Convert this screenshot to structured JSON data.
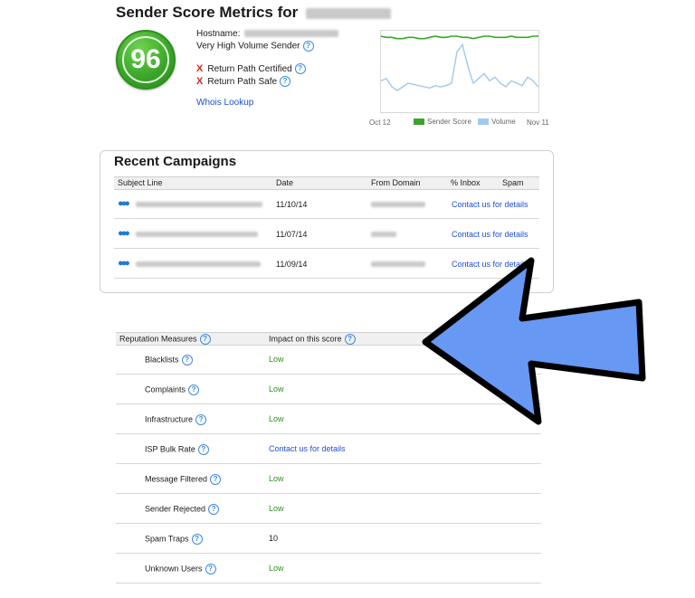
{
  "header": {
    "title": "Sender Score Metrics for",
    "score": "96",
    "hostname_label": "Hostname:",
    "volume_label": "Very High Volume Sender",
    "return_path_certified": "Return Path Certified",
    "return_path_safe": "Return Path Safe",
    "whois_link": "Whois Lookup",
    "x_mark": "X",
    "help_glyph": "?"
  },
  "trend_chart": {
    "x_start": "Oct 12",
    "x_end": "Nov 11",
    "legend": [
      "Sender Score",
      "Volume"
    ],
    "colors": {
      "score": "#3aa629",
      "volume": "#9ec9f0"
    }
  },
  "chart_data": {
    "type": "line",
    "x": [
      "Oct 12",
      "",
      "",
      "",
      "",
      "",
      "",
      "",
      "",
      "",
      "",
      "",
      "",
      "",
      "",
      "",
      "",
      "",
      "",
      "",
      "",
      "",
      "",
      "",
      "",
      "",
      "",
      "",
      "",
      "Nov 11"
    ],
    "series": [
      {
        "name": "Sender Score",
        "values": [
          97,
          96,
          96,
          95,
          95,
          96,
          96,
          95,
          95,
          96,
          97,
          96,
          96,
          97,
          97,
          96,
          96,
          95,
          96,
          97,
          97,
          96,
          96,
          96,
          97,
          96,
          96,
          96,
          97,
          97
        ]
      },
      {
        "name": "Volume",
        "values": [
          60,
          62,
          55,
          52,
          55,
          58,
          57,
          56,
          55,
          54,
          56,
          55,
          56,
          58,
          84,
          90,
          72,
          58,
          62,
          66,
          60,
          63,
          58,
          55,
          60,
          58,
          56,
          63,
          60,
          55
        ]
      }
    ],
    "ylim": [
      40,
      100
    ]
  },
  "campaigns": {
    "title": "Recent Campaigns",
    "columns": [
      "Subject Line",
      "Date",
      "From Domain",
      "% Inbox",
      "Spam"
    ],
    "rows": [
      {
        "date": "11/10/14",
        "inbox": "Contact us for details"
      },
      {
        "date": "11/07/14",
        "inbox": "Contact us for details"
      },
      {
        "date": "11/09/14",
        "inbox": "Contact us for details"
      }
    ]
  },
  "reputation": {
    "columns": [
      "Reputation Measures",
      "Impact on this score"
    ],
    "rows": [
      {
        "label": "Blacklists",
        "value": "Low"
      },
      {
        "label": "Complaints",
        "value": "Low"
      },
      {
        "label": "Infrastructure",
        "value": "Low"
      },
      {
        "label": "ISP Bulk Rate",
        "value": "Contact us for details"
      },
      {
        "label": "Message Filtered",
        "value": "Low"
      },
      {
        "label": "Sender Rejected",
        "value": "Low"
      },
      {
        "label": "Spam Traps",
        "value": "10"
      },
      {
        "label": "Unknown Users",
        "value": "Low"
      }
    ]
  }
}
